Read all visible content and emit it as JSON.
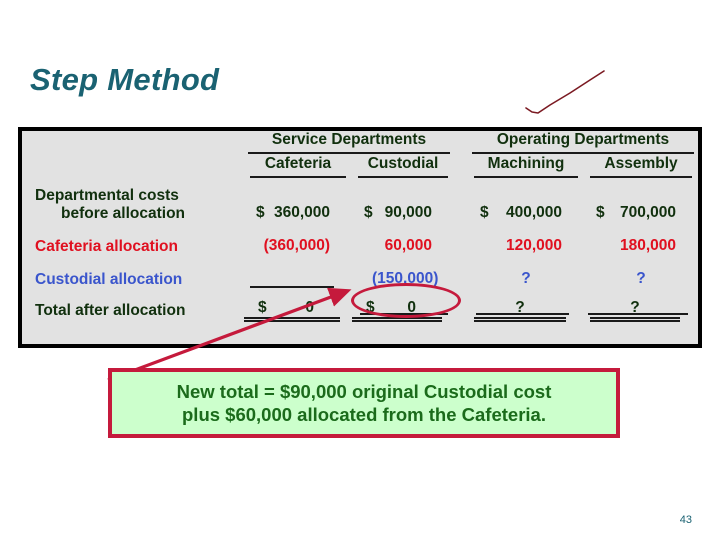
{
  "slide": {
    "title": "Step Method",
    "page_number": "43",
    "title_color": "#1A6272",
    "panel_bg": "#E2E2E2",
    "accent_red": "#E01020",
    "accent_blue": "#3A55CC",
    "accent_green": "#11300E",
    "highlight_crimson": "#C51A3C",
    "callout_bg": "#CCFFCC"
  },
  "table": {
    "group_headers": [
      {
        "label": "Service Departments",
        "span": 2
      },
      {
        "label": "Operating Departments",
        "span": 2
      }
    ],
    "columns": [
      {
        "key": "cafeteria",
        "label": "Cafeteria"
      },
      {
        "key": "custodial",
        "label": "Custodial"
      },
      {
        "key": "machining",
        "label": "Machining"
      },
      {
        "key": "assembly",
        "label": "Assembly"
      }
    ],
    "rows": [
      {
        "label_line1": "Departmental costs",
        "label_line2": "before allocation",
        "color": "green",
        "cells": [
          {
            "sign": "$",
            "value": "360,000"
          },
          {
            "sign": "$",
            "value": "90,000"
          },
          {
            "sign": "$",
            "value": "400,000"
          },
          {
            "sign": "$",
            "value": "700,000"
          }
        ]
      },
      {
        "label_line1": "Cafeteria allocation",
        "label_line2": "",
        "color": "red",
        "cells": [
          {
            "sign": "",
            "value": "(360,000)"
          },
          {
            "sign": "",
            "value": "60,000"
          },
          {
            "sign": "",
            "value": "120,000"
          },
          {
            "sign": "",
            "value": "180,000"
          }
        ]
      },
      {
        "label_line1": "Custodial allocation",
        "label_line2": "",
        "color": "blue",
        "cells": [
          {
            "sign": "",
            "value": ""
          },
          {
            "sign": "",
            "value": "(150,000)"
          },
          {
            "sign": "",
            "value": "?"
          },
          {
            "sign": "",
            "value": "?"
          }
        ]
      },
      {
        "label_line1": "Total after allocation",
        "label_line2": "",
        "color": "green",
        "cells": [
          {
            "sign": "$",
            "value": "0"
          },
          {
            "sign": "$",
            "value": "0"
          },
          {
            "sign": "",
            "value": "?"
          },
          {
            "sign": "",
            "value": "?"
          }
        ]
      }
    ]
  },
  "callout": {
    "line1": "New total = $90,000 original Custodial cost",
    "line2": "plus $60,000 allocated from the Cafeteria."
  }
}
